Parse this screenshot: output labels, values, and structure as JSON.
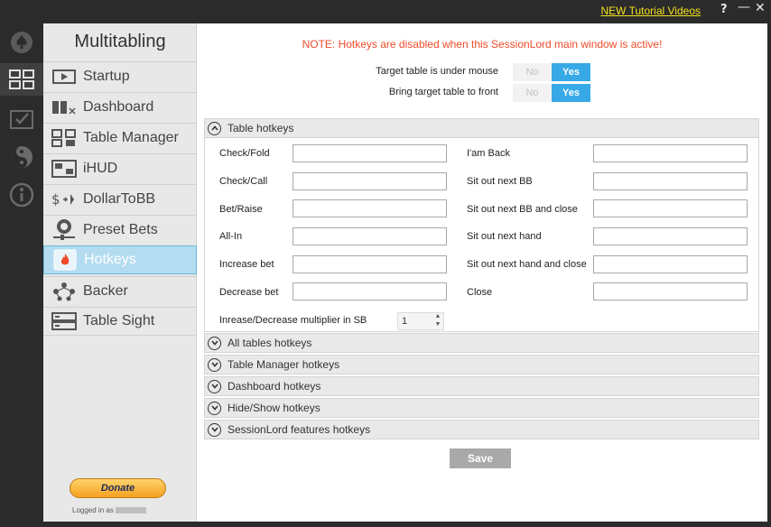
{
  "topbar": {
    "tutorial_link": "NEW Tutorial Videos",
    "help": "?",
    "minimize": "—",
    "close": "✕"
  },
  "rail": {
    "icons": [
      "spade-icon",
      "layout-grid-icon",
      "checkbox-icon",
      "yin-yang-icon",
      "info-icon"
    ],
    "active_index": 1
  },
  "sidebar": {
    "title": "Multitabling",
    "items": [
      {
        "label": "Startup",
        "icon": "startup-icon"
      },
      {
        "label": "Dashboard",
        "icon": "dashboard-icon"
      },
      {
        "label": "Table Manager",
        "icon": "table-manager-icon"
      },
      {
        "label": "iHUD",
        "icon": "ihud-icon"
      },
      {
        "label": "DollarToBB",
        "icon": "dollar-to-bb-icon"
      },
      {
        "label": "Preset Bets",
        "icon": "preset-bets-icon"
      },
      {
        "label": "Hotkeys",
        "icon": "flame-icon"
      },
      {
        "label": "Backer",
        "icon": "backer-icon"
      },
      {
        "label": "Table Sight",
        "icon": "table-sight-icon"
      }
    ],
    "active_item": "Hotkeys",
    "donate_label": "Donate",
    "logged_in_label": "Logged in as"
  },
  "main": {
    "notice": "NOTE: Hotkeys are disabled when this SessionLord main window is active!",
    "toggles": [
      {
        "label": "Target table is under mouse",
        "no": "No",
        "yes": "Yes",
        "value": "Yes"
      },
      {
        "label": "Bring target table to front",
        "no": "No",
        "yes": "Yes",
        "value": "Yes"
      }
    ],
    "table_hotkeys": {
      "title": "Table hotkeys",
      "left": [
        {
          "label": "Check/Fold",
          "value": ""
        },
        {
          "label": "Check/Call",
          "value": ""
        },
        {
          "label": "Bet/Raise",
          "value": ""
        },
        {
          "label": "All-In",
          "value": ""
        },
        {
          "label": "Increase bet",
          "value": ""
        },
        {
          "label": "Decrease bet",
          "value": ""
        }
      ],
      "right": [
        {
          "label": "I'am Back",
          "value": ""
        },
        {
          "label": "Sit out next BB",
          "value": ""
        },
        {
          "label": "Sit out next BB and close",
          "value": ""
        },
        {
          "label": "Sit out next hand",
          "value": ""
        },
        {
          "label": "Sit out next hand and close",
          "value": ""
        },
        {
          "label": "Close",
          "value": ""
        }
      ],
      "multiplier_label": "Inrease/Decrease multiplier in SB",
      "multiplier_value": "1"
    },
    "collapsed_sections": [
      "All tables hotkeys",
      "Table Manager hotkeys",
      "Dashboard hotkeys",
      "Hide/Show hotkeys",
      "SessionLord features hotkeys"
    ],
    "save_label": "Save"
  },
  "colors": {
    "accent": "#37a9e6",
    "notice": "#ef4b2a",
    "link": "#f4e21c",
    "active_nav": "#b3dcf0"
  }
}
